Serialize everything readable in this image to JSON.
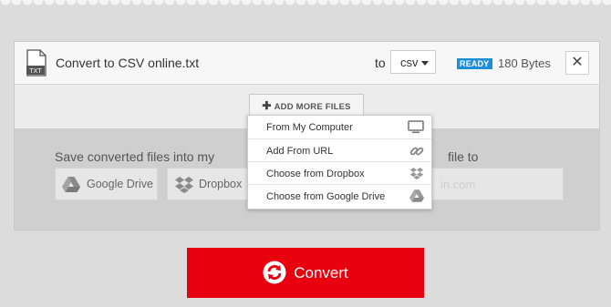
{
  "file": {
    "icon_label": "TXT",
    "name": "Convert to CSV online.txt",
    "to_label": "to",
    "format": "csv",
    "status": "READY",
    "size": "180 Bytes",
    "close_symbol": "✕"
  },
  "add_more": {
    "label": "ADD MORE FILES",
    "menu": [
      {
        "label": "From My Computer",
        "icon": "monitor-icon"
      },
      {
        "label": "Add From URL",
        "icon": "link-icon"
      },
      {
        "label": "Choose from Dropbox",
        "icon": "dropbox-icon"
      },
      {
        "label": "Choose from Google Drive",
        "icon": "google-drive-icon"
      }
    ]
  },
  "save": {
    "label": "Save converted files into my",
    "google_drive": "Google Drive",
    "dropbox": "Dropbox",
    "file_to_label": "file to",
    "url_placeholder_fragment": "in.com"
  },
  "convert": {
    "label": "Convert"
  },
  "colors": {
    "accent_red": "#e8000e",
    "ready_blue": "#1e8ed6",
    "page_bg": "#dcdcdc"
  }
}
